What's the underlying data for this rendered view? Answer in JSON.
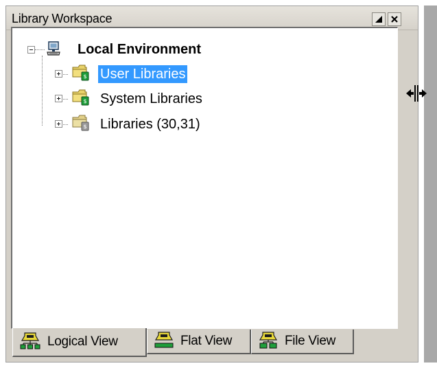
{
  "window": {
    "title": "Library Workspace"
  },
  "titlebar_buttons": {
    "minmax_icon": "maximize-icon",
    "close_icon": "close-icon"
  },
  "tree": {
    "root": {
      "label": "Local Environment",
      "icon": "computer-icon",
      "expander": "minus"
    },
    "children": [
      {
        "label": "User Libraries",
        "icon": "library-folder-green-icon",
        "expander": "plus",
        "selected": true
      },
      {
        "label": "System Libraries",
        "icon": "library-folder-green-icon",
        "expander": "plus",
        "selected": false
      },
      {
        "label": "Libraries (30,31)",
        "icon": "library-folder-gray-icon",
        "expander": "plus",
        "selected": false
      }
    ]
  },
  "tabs": [
    {
      "label": "Logical View",
      "icon": "logical-view-icon",
      "active": true
    },
    {
      "label": "Flat View",
      "icon": "flat-view-icon",
      "active": false
    },
    {
      "label": "File View",
      "icon": "file-view-icon",
      "active": false
    }
  ],
  "colors": {
    "selection": "#3399ff",
    "panel_bg": "#d4d0c8",
    "folder": "#e8d26a",
    "badge_green": "#1e9e3a",
    "badge_gray": "#9a9a9a"
  }
}
